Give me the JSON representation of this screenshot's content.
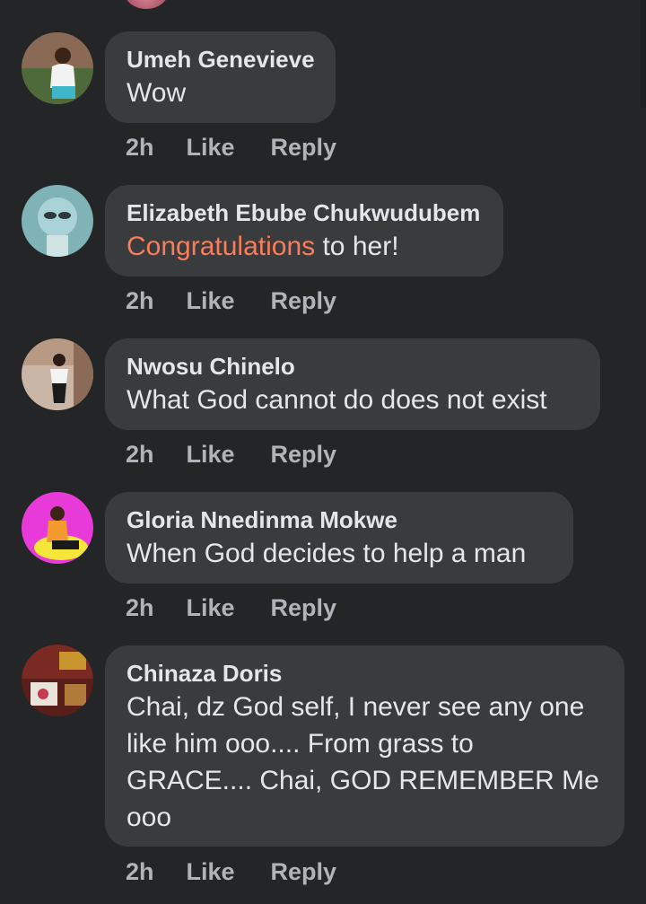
{
  "comments": [
    {
      "author": "Umeh Genevieve",
      "text": "Wow",
      "time": "2h",
      "like_label": "Like",
      "reply_label": "Reply"
    },
    {
      "author": "Elizabeth Ebube Chukwudubem",
      "text_highlight": "Congratulations",
      "text_rest": " to her!",
      "time": "2h",
      "like_label": "Like",
      "reply_label": "Reply"
    },
    {
      "author": "Nwosu Chinelo",
      "text": "What God cannot do does not exist",
      "time": "2h",
      "like_label": "Like",
      "reply_label": "Reply"
    },
    {
      "author": "Gloria Nnedinma Mokwe",
      "text": "When God decides to help a man",
      "time": "2h",
      "like_label": "Like",
      "reply_label": "Reply"
    },
    {
      "author": "Chinaza Doris",
      "text": "Chai, dz God self, I never see any one like him ooo.... From grass to GRACE.... Chai, GOD REMEMBER Me ooo",
      "time": "2h",
      "like_label": "Like",
      "reply_label": "Reply"
    }
  ],
  "colors": {
    "background": "#242527",
    "bubble": "#3a3b3c",
    "text": "#e4e6eb",
    "meta": "#b0b3b8",
    "highlight": "#f97c5b"
  }
}
